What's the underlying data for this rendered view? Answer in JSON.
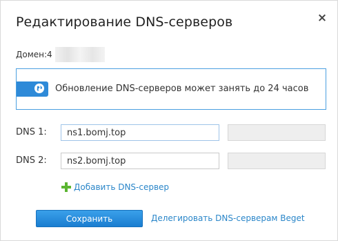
{
  "dialog": {
    "title": "Редактирование DNS-серверов",
    "close_glyph": "×"
  },
  "domain": {
    "label": "Домен: ",
    "value_fragment": "4"
  },
  "notice": {
    "icon": "globe-icon",
    "text": "Обновление DNS-серверов может занять до 24 часов"
  },
  "dns": [
    {
      "label": "DNS 1:",
      "value": "ns1.bomj.top",
      "ip": ""
    },
    {
      "label": "DNS 2:",
      "value": "ns2.bomj.top",
      "ip": ""
    }
  ],
  "actions": {
    "add_label": "Добавить DNS-сервер",
    "save_label": "Сохранить",
    "delegate_label": "Делегировать DNS-серверам Beget"
  },
  "colors": {
    "accent": "#2e8ad8",
    "link": "#2a86c9",
    "plus_green": "#5bb531"
  }
}
